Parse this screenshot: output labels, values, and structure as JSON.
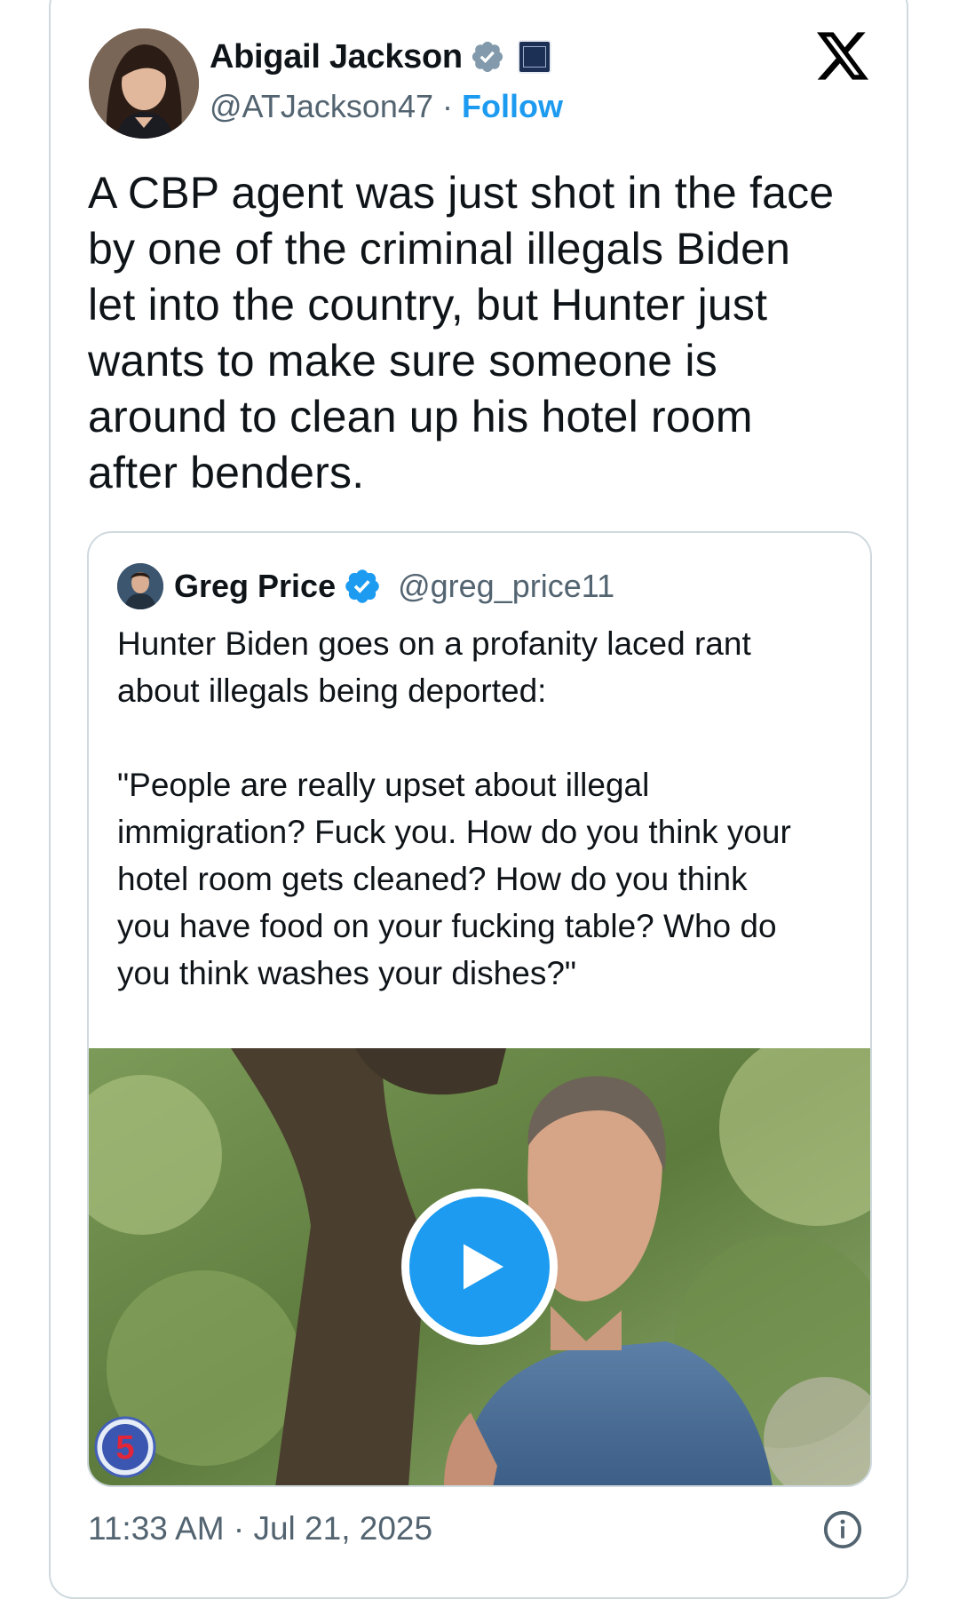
{
  "tweet": {
    "author_name": "Abigail Jackson",
    "author_handle": "@ATJackson47",
    "handle_separator": " · ",
    "follow_label": "Follow",
    "text": "A CBP agent was just shot in the face\nby one of the criminal illegals Biden\nlet into the country, but Hunter just\nwants to make sure someone is\naround to clean up his hotel room\nafter benders.",
    "timestamp": "11:33 AM · Jul 21, 2025"
  },
  "quote": {
    "author_name": "Greg Price",
    "author_handle": "@greg_price11",
    "text": "Hunter Biden goes on a profanity laced rant\nabout illegals being deported:\n\n\"People are really upset about illegal\nimmigration? Fuck you. How do you think your\nhotel room gets cleaned? How do you think\nyou have food on your fucking table? Who do\nyou think washes your dishes?\"",
    "video_watermark": "5"
  },
  "icons": {
    "verified": "verified-badge-icon",
    "affiliation": "white-house-affiliation-icon",
    "brand": "x-logo-icon",
    "play": "play-icon",
    "info": "info-icon"
  },
  "colors": {
    "accent": "#1d9bf0",
    "text": "#0f1419",
    "secondary": "#536471",
    "border": "#cfd9de"
  }
}
